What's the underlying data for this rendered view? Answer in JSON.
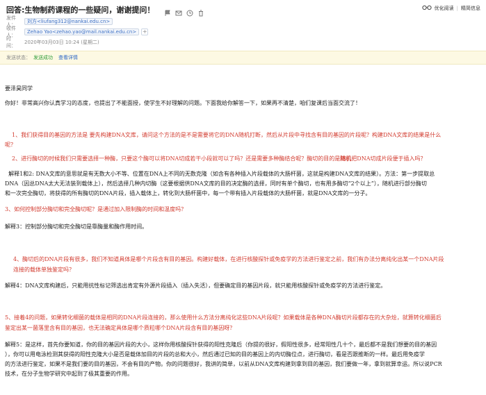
{
  "subject": "回答:生物制药课程的一些疑问，谢谢提问！",
  "toolbar": {
    "optimize_label": "优化阅读",
    "simple_label": "精简信息",
    "separator": "|"
  },
  "meta": {
    "from_label": "发件人：",
    "from_value": "刘方<liufang312@nankai.edu.cn>",
    "to_label": "收件人：",
    "to_value": "Zehao Yao<zehao.yao@mail.nankai.edu.cn>",
    "time_label": "时　间：",
    "time_value": "2020年03月03日 10:24 (星期二)"
  },
  "status": {
    "label": "发送状态：",
    "value": "发送成功",
    "details_link": "查看详情"
  },
  "body": {
    "greeting": "要泽昊同学",
    "intro": "你好！非常高兴你认真学习的态度，也提出了不能面授，使学生不好理解的问题。下面我给你解答一下，如果再不清楚，咱们复课后当面交流了！",
    "q1_a": "1、我们获得目的基因的方法是 要先构建DNA文库，请问这个方法的是不是需要将它的DNA随机打断，然后从片段中寻找含有目的基因的片段呢？构建DNA文库的结果是什么",
    "q1_b": "呢？",
    "q2_a": "2、进行酶切的时候我们只需要选择一种酶，只要这个酶可以将DNA切成若干小段就可以了吗？还是需要多种酶结合呢？酶切的目的是",
    "q2_em": "随机",
    "q2_b": "把DNA切成片段便于插入吗？",
    "a12_a": "  解释1和2: DNA文库的意思就是有无数大小不等、位置在DNA上不同的无数克隆（如含有各种插入片段载体的大肠杆菌，这就是构建DNA文库的结果）。方法：第一步提取总",
    "a12_b": "DNA（因总DNA太大无法装到载体上），然后选择几种内切酶（这要根据供DNA文库的目的决定酶的选择，同时有单个酶切，也有用多酶切“2个以上”），随机进行部分酶切",
    "a12_c": "和一次完全酶切，将获得的所有酶切的DNA片段，插入载体上，转化到大肠杆菌中，每一个带有插入片段载体的大肠杆菌，就是DNA文库的一分子。",
    "q3": "3、如何控制部分酶切和完全酶切呢？是通过加入限制酶的时间和温度吗？",
    "a3": "解释3：控制部分酶切和完全酶切是靠酶量和酶作用时间。",
    "q4_a": "4、酶切后的DNA片段有很多，我们不知道具体是哪个片段含有目的基因。构建好载体，在进行核酸探针或免疫学的方法进行鉴定之前，我们有办法分离纯化出某一个DNA片段",
    "q4_b": "连接的载体单独鉴定吗？",
    "a4": "解释4：DNA文库构建后，只能用抗性标记筛选出肯定有外源片段插入（插入失活），但要确定目的基因片段，就只能用核酸探针或免疫学的方法进行鉴定。",
    "q5_a": "5、接着4的问题，如果转化细菌的载体是相同的DNA片段连接的，那么使用什么方法分离纯化这些DNA片段呢？如果载体是各种DNA酶切片段都存在的大杂烩，就算转化细菌后",
    "q5_b": "鉴定出某一菌落里含有目的基因，也无法确定具体是哪个质粒哪个DNA片段含有目的基因呀？",
    "a5_a": "解释5：是这样，首先你要知道，你的目的基因片段的大小，这样你用核酸探针获得的阳性克隆后（你提的很好，假阳性很多，经常阳性几十个，最后都不是我们想要的目的基因",
    "a5_b": "），你可以用电泳检测其获得的阳性克隆大小是否是载体加目的片段的总和大小，然后通过已知的目的基因上的内切酶位点，进行酶切，看是否跟推断的一样。最后用免疫学",
    "a5_c": "的方法进行鉴定，如果不是我们要的目的基因，不会有目的产物。你的问题很好，我讲的简单，以前从DNA文库构建到拿到目的基因，我们要做一年，拿到就算幸运。所以说PCR",
    "a5_d": "技术，在分子生物学研究中起到了极其重要的作用。"
  }
}
